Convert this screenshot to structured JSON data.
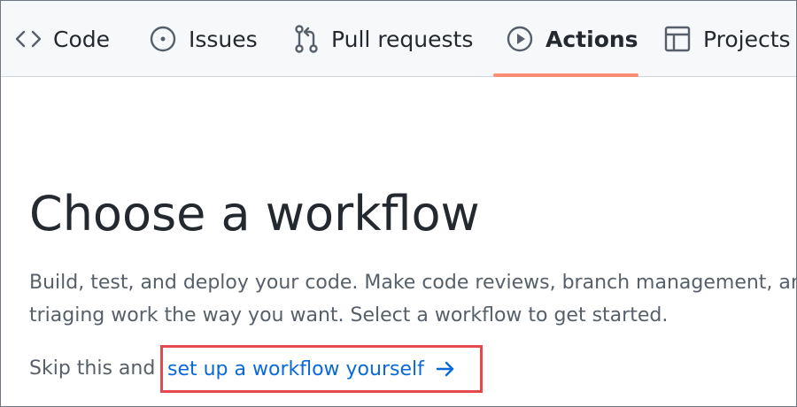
{
  "nav": {
    "tabs": [
      {
        "label": "Code",
        "icon": "code-icon",
        "selected": false
      },
      {
        "label": "Issues",
        "icon": "issue-opened-icon",
        "selected": false
      },
      {
        "label": "Pull requests",
        "icon": "git-pull-request-icon",
        "selected": false
      },
      {
        "label": "Actions",
        "icon": "play-icon",
        "selected": true
      },
      {
        "label": "Projects",
        "icon": "table-icon",
        "selected": false
      }
    ],
    "active_underline_color": "#fd8c73"
  },
  "main": {
    "title": "Choose a workflow",
    "subtitle": "Build, test, and deploy your code. Make code reviews, branch management, and issue triaging work the way you want. Select a workflow to get started.",
    "skip_prefix": "Skip this and",
    "setup_link": {
      "label": "set up a workflow yourself",
      "icon": "arrow-right-icon",
      "highlight_color": "#e5484d"
    }
  },
  "colors": {
    "text": "#24292f",
    "muted": "#57606a",
    "link": "#0969da"
  }
}
